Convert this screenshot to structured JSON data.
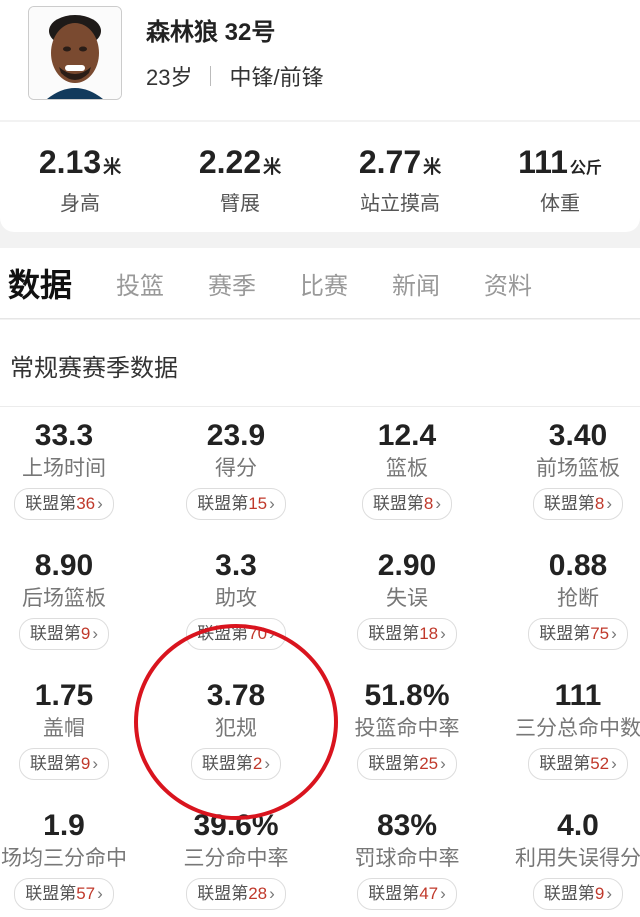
{
  "player": {
    "team_number": "森林狼 32号",
    "age": "23岁",
    "position": "中锋/前锋"
  },
  "measurements": [
    {
      "value": "2.13",
      "unit": "米",
      "label": "身高"
    },
    {
      "value": "2.22",
      "unit": "米",
      "label": "臂展"
    },
    {
      "value": "2.77",
      "unit": "米",
      "label": "站立摸高"
    },
    {
      "value": "111",
      "unit": "公斤",
      "label": "体重"
    }
  ],
  "tabs": [
    "数据",
    "投篮",
    "赛季",
    "比赛",
    "新闻",
    "资料"
  ],
  "section_title": "常规赛赛季数据",
  "rank_prefix": "联盟第",
  "stats": [
    {
      "value": "33.3",
      "label": "上场时间",
      "rank": "36"
    },
    {
      "value": "23.9",
      "label": "得分",
      "rank": "15"
    },
    {
      "value": "12.4",
      "label": "篮板",
      "rank": "8"
    },
    {
      "value": "3.40",
      "label": "前场篮板",
      "rank": "8"
    },
    {
      "value": "8.90",
      "label": "后场篮板",
      "rank": "9"
    },
    {
      "value": "3.3",
      "label": "助攻",
      "rank": "70"
    },
    {
      "value": "2.90",
      "label": "失误",
      "rank": "18"
    },
    {
      "value": "0.88",
      "label": "抢断",
      "rank": "75"
    },
    {
      "value": "1.75",
      "label": "盖帽",
      "rank": "9"
    },
    {
      "value": "3.78",
      "label": "犯规",
      "rank": "2"
    },
    {
      "value": "51.8%",
      "label": "投篮命中率",
      "rank": "25"
    },
    {
      "value": "111",
      "label": "三分总命中数",
      "rank": "52"
    },
    {
      "value": "1.9",
      "label": "场均三分命中",
      "rank": "57"
    },
    {
      "value": "39.6%",
      "label": "三分命中率",
      "rank": "28"
    },
    {
      "value": "83%",
      "label": "罚球命中率",
      "rank": "47"
    },
    {
      "value": "4.0",
      "label": "利用失误得分",
      "rank": "9"
    }
  ],
  "colors": {
    "accent_red": "#d9141e",
    "rank_red": "#c0392b"
  }
}
